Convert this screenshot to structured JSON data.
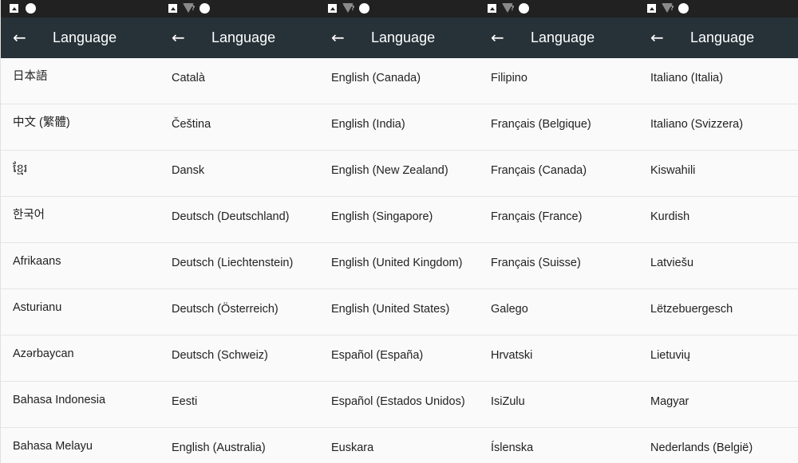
{
  "screens": [
    {
      "title": "Language",
      "items": [
        "日本語",
        "中文 (繁體)",
        "ខ្មែរ",
        "한국어",
        "Afrikaans",
        "Asturianu",
        "Azərbaycan",
        "Bahasa Indonesia",
        "Bahasa Melayu"
      ]
    },
    {
      "title": "Language",
      "items": [
        "Català",
        "Čeština",
        "Dansk",
        "Deutsch (Deutschland)",
        "Deutsch (Liechtenstein)",
        "Deutsch (Österreich)",
        "Deutsch (Schweiz)",
        "Eesti",
        "English (Australia)"
      ]
    },
    {
      "title": "Language",
      "items": [
        "English (Canada)",
        "English (India)",
        "English (New Zealand)",
        "English (Singapore)",
        "English (United Kingdom)",
        "English (United States)",
        "Español (España)",
        "Español (Estados Unidos)",
        "Euskara"
      ]
    },
    {
      "title": "Language",
      "items": [
        "Filipino",
        "Français (Belgique)",
        "Français (Canada)",
        "Français (France)",
        "Français (Suisse)",
        "Galego",
        "Hrvatski",
        "IsiZulu",
        "Íslenska"
      ]
    },
    {
      "title": "Language",
      "items": [
        "Italiano (Italia)",
        "Italiano (Svizzera)",
        "Kiswahili",
        "Kurdish",
        "Latviešu",
        "Lëtzebuergesch",
        "Lietuvių",
        "Magyar",
        "Nederlands (België)"
      ]
    }
  ],
  "status_bar": {
    "wifi_unknown_glyph": "?",
    "icons": [
      "image-icon",
      "wifi-icon",
      "notification-dot-icon"
    ]
  },
  "icons": {
    "back": "arrow-back-icon",
    "back_glyph": "←"
  },
  "colors": {
    "status_bar": "#212121",
    "app_bar": "#263238",
    "list_background": "#fafafa",
    "divider": "#e5e5e5",
    "text": "#222222"
  }
}
